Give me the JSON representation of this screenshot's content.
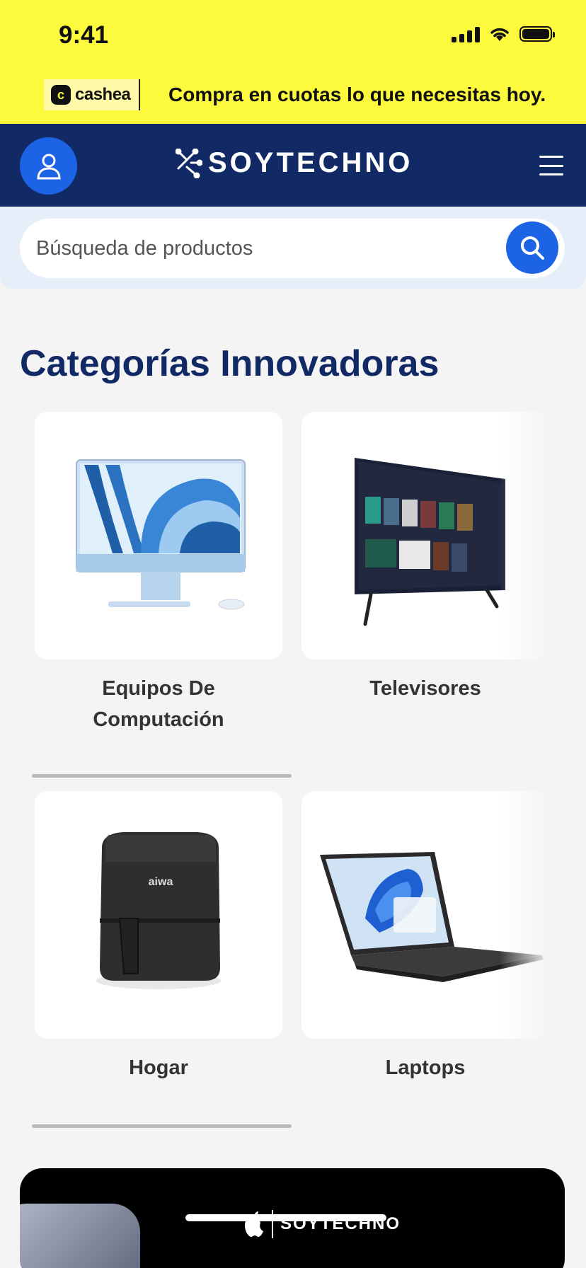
{
  "status_bar": {
    "time": "9:41"
  },
  "promo": {
    "brand": "cashea",
    "text": "Compra en cuotas lo que necesitas hoy."
  },
  "header": {
    "brand": "SOYTECHNO"
  },
  "search": {
    "placeholder": "Búsqueda de productos"
  },
  "section": {
    "title": "Categorías Innovadoras"
  },
  "categories": [
    {
      "label_line1": "Equipos De",
      "label_line2": "Computación",
      "icon": "desktop-computer"
    },
    {
      "label": "Televisores",
      "icon": "television"
    },
    {
      "label": "Hogar",
      "icon": "air-fryer"
    },
    {
      "label": "Laptops",
      "icon": "laptop"
    }
  ],
  "banner": {
    "brand": "SOYTECHNO"
  },
  "colors": {
    "banner_yellow": "#fdfa3e",
    "navy": "#112a66",
    "accent_blue": "#1d63e6",
    "background": "#f4f4f4"
  }
}
